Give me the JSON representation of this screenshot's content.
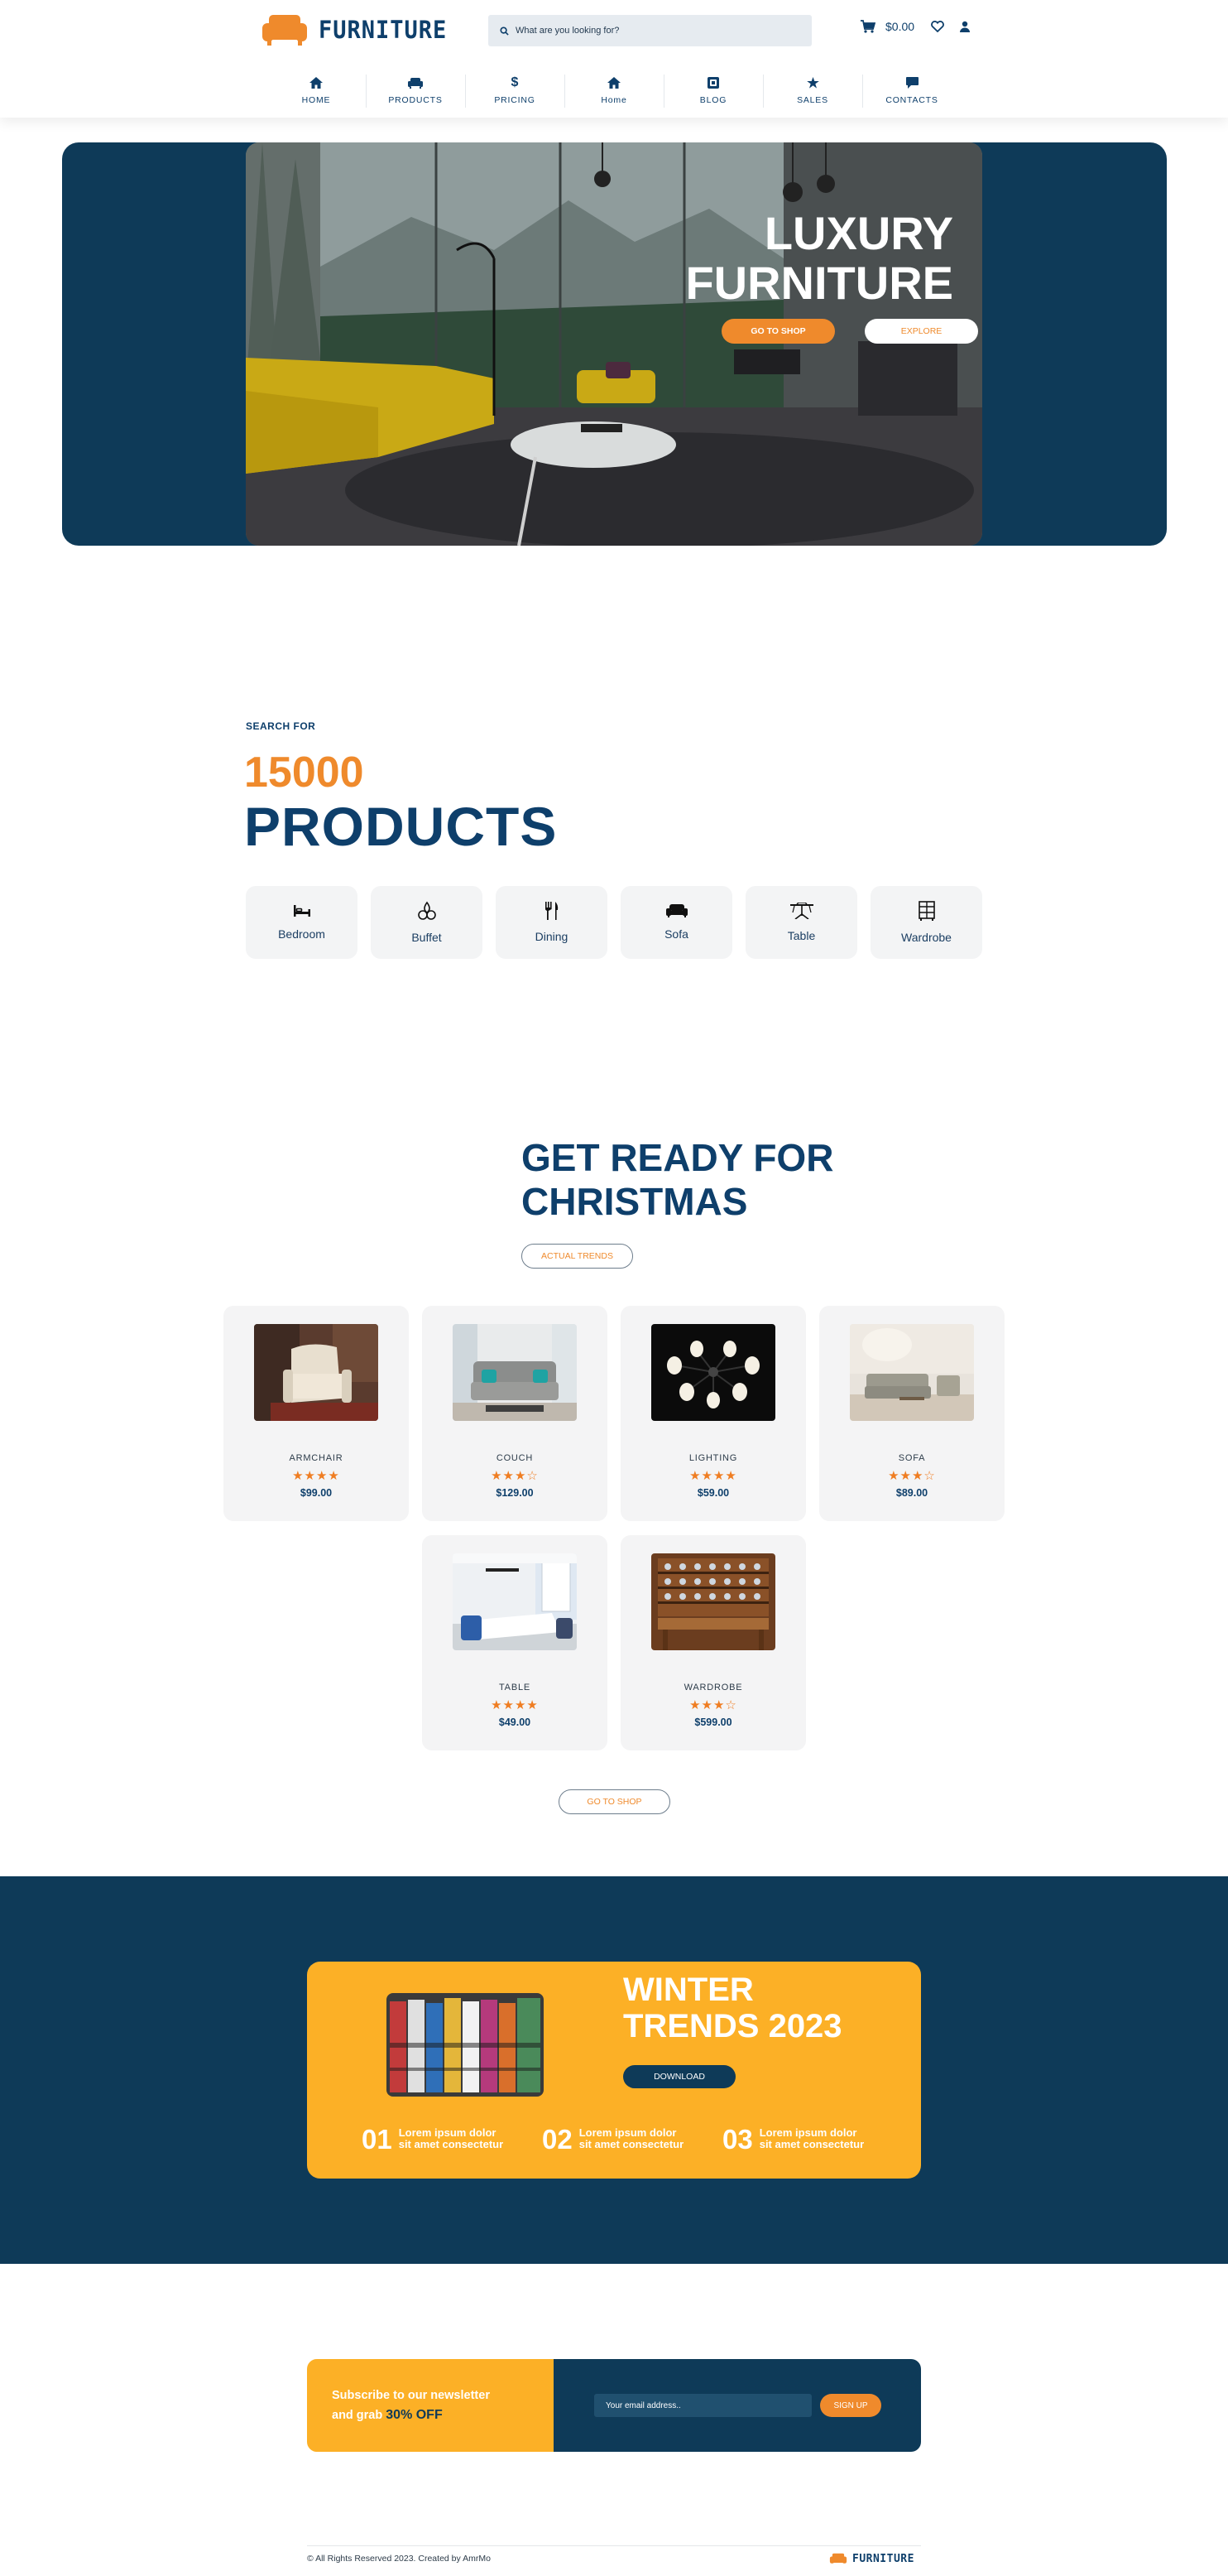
{
  "brand": {
    "name": "FURNITURE",
    "accent": "#ef8a2c",
    "navy": "#0e3f6b",
    "yellow": "#fcb026"
  },
  "header": {
    "search_placeholder": "What are you looking for?",
    "cart_amount": "$0.00",
    "nav": [
      {
        "label": "HOME",
        "icon": "home-icon"
      },
      {
        "label": "PRODUCTS",
        "icon": "sofa-icon"
      },
      {
        "label": "PRICING",
        "icon": "dollar-icon"
      },
      {
        "label": "Home",
        "icon": "home-icon"
      },
      {
        "label": "BLOG",
        "icon": "blog-icon"
      },
      {
        "label": "SALES",
        "icon": "star-icon"
      },
      {
        "label": "CONTACTS",
        "icon": "chat-icon"
      }
    ]
  },
  "hero": {
    "title_line1": "LUXURY",
    "title_line2": "FURNITURE",
    "primary_button": "GO TO SHOP",
    "secondary_button": "EXPLORE"
  },
  "search_section": {
    "kicker": "SEARCH FOR",
    "number": "15000",
    "word": "PRODUCTS",
    "categories": [
      {
        "label": "Bedroom",
        "icon": "bed-icon"
      },
      {
        "label": "Buffet",
        "icon": "buffet-icon"
      },
      {
        "label": "Dining",
        "icon": "dining-icon"
      },
      {
        "label": "Sofa",
        "icon": "sofa-icon"
      },
      {
        "label": "Table",
        "icon": "table-icon"
      },
      {
        "label": "Wardrobe",
        "icon": "wardrobe-icon"
      }
    ]
  },
  "christmas": {
    "title_line1": "GET READY FOR",
    "title_line2": "CHRISTMAS",
    "trends_button": "ACTUAL TRENDS",
    "shop_button": "GO TO SHOP",
    "products": [
      {
        "name": "ARMCHAIR",
        "price": "$99.00",
        "stars": "★★★★",
        "rating": 4
      },
      {
        "name": "COUCH",
        "price": "$129.00",
        "stars": "★★★☆",
        "rating": 3
      },
      {
        "name": "LIGHTING",
        "price": "$59.00",
        "stars": "★★★★",
        "rating": 4
      },
      {
        "name": "SOFA",
        "price": "$89.00",
        "stars": "★★★☆",
        "rating": 3
      },
      {
        "name": "TABLE",
        "price": "$49.00",
        "stars": "★★★★",
        "rating": 4
      },
      {
        "name": "WARDROBE",
        "price": "$599.00",
        "stars": "★★★☆",
        "rating": 3
      }
    ]
  },
  "winter": {
    "title_line1": "WINTER",
    "title_line2": "TRENDS 2023",
    "button": "DOWNLOAD",
    "steps": [
      {
        "num": "01",
        "text": "Lorem ipsum dolor sit amet consectetur"
      },
      {
        "num": "02",
        "text": "Lorem ipsum dolor sit amet consectetur"
      },
      {
        "num": "03",
        "text": "Lorem ipsum dolor sit amet consectetur"
      }
    ]
  },
  "newsletter": {
    "line1": "Subscribe to our newsletter",
    "line2_prefix": "and grab",
    "discount": "30% OFF",
    "email_placeholder": "Your email address..",
    "button": "SIGN UP"
  },
  "footer": {
    "copyright": "© All Rights Reserved 2023. Created by AmrMo",
    "brand": "FURNITURE"
  }
}
